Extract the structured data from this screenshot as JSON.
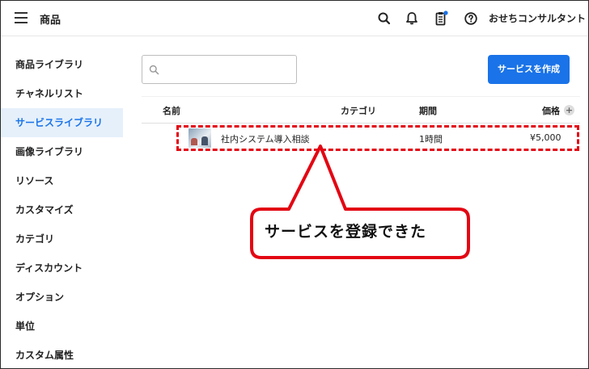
{
  "header": {
    "title": "商品",
    "user_name": "おせちコンサルタント",
    "icons": [
      "menu-icon",
      "search-icon",
      "bell-icon",
      "clipboard-icon",
      "help-icon"
    ],
    "notification_dot_color": "#1a73e8"
  },
  "sidebar": {
    "items": [
      {
        "label": "商品ライブラリ",
        "active": false
      },
      {
        "label": "チャネルリスト",
        "active": false
      },
      {
        "label": "サービスライブラリ",
        "active": true
      },
      {
        "label": "画像ライブラリ",
        "active": false
      },
      {
        "label": "リソース",
        "active": false
      },
      {
        "label": "カスタマイズ",
        "active": false
      },
      {
        "label": "カテゴリ",
        "active": false
      },
      {
        "label": "ディスカウント",
        "active": false
      },
      {
        "label": "オプション",
        "active": false
      },
      {
        "label": "単位",
        "active": false
      },
      {
        "label": "カスタム属性",
        "active": false
      }
    ]
  },
  "main": {
    "search": {
      "value": "",
      "placeholder": ""
    },
    "create_button": "サービスを作成",
    "table": {
      "columns": [
        "名前",
        "カテゴリ",
        "期間",
        "価格"
      ],
      "add_column_symbol": "+",
      "rows": [
        {
          "name": "社内システム導入相談",
          "category": "",
          "period": "1時間",
          "price": "¥5,000"
        }
      ]
    }
  },
  "annotation": {
    "text": "サービスを登録できた",
    "color": "#e30613"
  },
  "colors": {
    "accent": "#1a73e8",
    "active_bg": "#e5f0fb",
    "highlight": "#e30613"
  }
}
